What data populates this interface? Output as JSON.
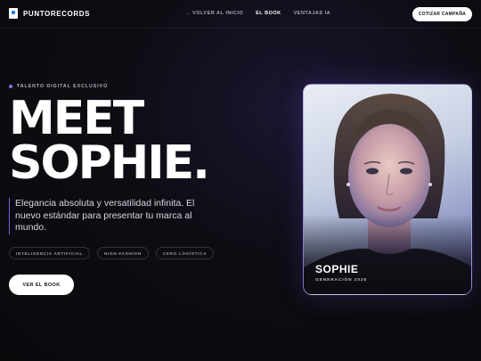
{
  "nav": {
    "brand": "PUNTORECORDS",
    "links": [
      {
        "label": "← VOLVER AL INICIO"
      },
      {
        "label": "EL BOOK"
      },
      {
        "label": "VENTAJAS IA"
      }
    ],
    "cta": "COTIZAR CAMPAÑA"
  },
  "hero": {
    "eyebrow": "TALENTO DIGITAL EXCLUSIVO",
    "headline_line1": "MEET",
    "headline_line2": "SOPHIE.",
    "lead": "Elegancia absoluta y versatilidad infinita. El nuevo estándar para presentar tu marca al mundo.",
    "chips": [
      "INTELIGENCIA ARTIFICIAL",
      "HIGH-FASHION",
      "CERO LOGÍSTICA"
    ],
    "button": "VER EL BOOK"
  },
  "card": {
    "name": "SOPHIE",
    "subtitle": "GENERACIÓN 2026"
  },
  "colors": {
    "accent": "#8f6df2",
    "background": "#0a0a0d"
  }
}
